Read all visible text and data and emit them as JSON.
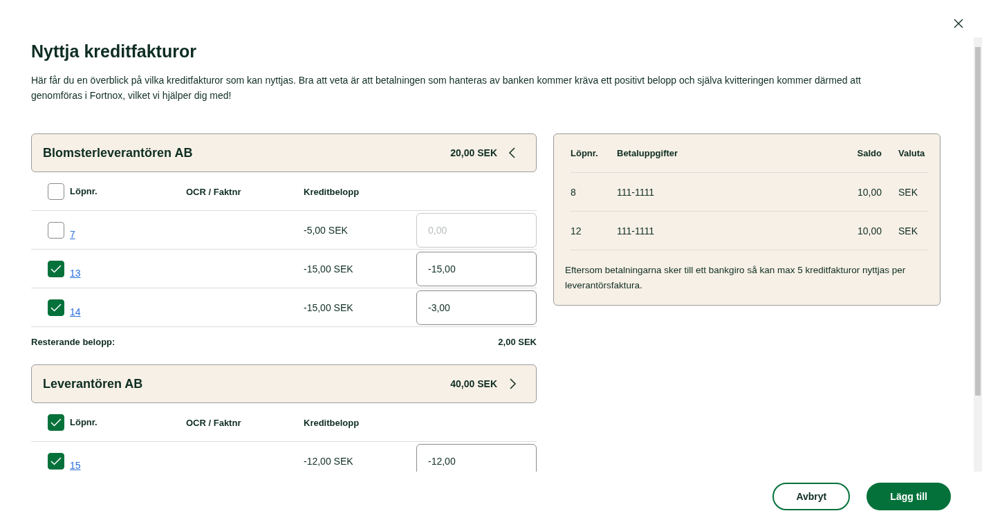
{
  "dialog": {
    "title": "Nyttja kreditfakturor",
    "description": "Här får du en överblick på vilka kreditfakturor som kan nyttjas. Bra att veta är att betalningen som hanteras av banken kommer kräva ett positivt belopp och själva kvitteringen kommer därmed att genomföras i Fortnox, vilket vi hjälper dig med!",
    "suppliers": [
      {
        "name": "Blomsterleverantören AB",
        "total": "20,00 SEK",
        "expanded": true,
        "all_checked": false,
        "columns": [
          "Löpnr.",
          "OCR / Faktnr",
          "Kreditbelopp"
        ],
        "rows": [
          {
            "checked": false,
            "number": "7",
            "amount": "-5,00 SEK",
            "placeholder": "0,00"
          },
          {
            "checked": true,
            "number": "13",
            "amount": "-15,00 SEK",
            "value": "-15,00"
          },
          {
            "checked": true,
            "number": "14",
            "amount": "-15,00 SEK",
            "value": "-3,00"
          }
        ],
        "remaining": {
          "label": "Resterande belopp:",
          "amount": "2,00 SEK"
        }
      },
      {
        "name": "Leverantören AB",
        "total": "40,00 SEK",
        "expanded": false,
        "all_checked": true,
        "columns": [
          "Löpnr.",
          "OCR / Faktnr",
          "Kreditbelopp"
        ],
        "rows": [
          {
            "checked": true,
            "number": "15",
            "amount": "-12,00 SEK",
            "value": "-12,00"
          }
        ]
      }
    ],
    "payment_table": {
      "columns": [
        "Löpnr.",
        "Betaluppgifter",
        "Saldo",
        "Valuta"
      ],
      "rows": [
        [
          "8",
          "111-1111",
          "10,00",
          "SEK"
        ],
        [
          "12",
          "111-1111",
          "10,00",
          "SEK"
        ]
      ],
      "note": "Eftersom betalningarna sker till ett bankgiro så kan max 5 kreditfakturor nyttjas per leverantörsfaktura."
    },
    "buttons": [
      {
        "label": "Avbryt",
        "kind": "secondary"
      },
      {
        "label": "Lägg till",
        "kind": "primary"
      }
    ]
  }
}
